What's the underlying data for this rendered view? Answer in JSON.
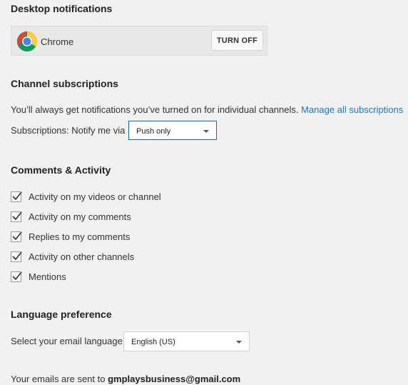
{
  "desktop_notifications": {
    "title": "Desktop notifications",
    "browser_name": "Chrome",
    "turn_off_label": "TURN OFF"
  },
  "channel_subscriptions": {
    "title": "Channel subscriptions",
    "description": "You’ll always get notifications you’ve turned on for individual channels.",
    "manage_link": "Manage all subscriptions",
    "notify_label": "Subscriptions: Notify me via",
    "notify_value": "Push only"
  },
  "comments_activity": {
    "title": "Comments & Activity",
    "items": [
      {
        "label": "Activity on my videos or channel",
        "checked": true
      },
      {
        "label": "Activity on my comments",
        "checked": true
      },
      {
        "label": "Replies to my comments",
        "checked": true
      },
      {
        "label": "Activity on other channels",
        "checked": true
      },
      {
        "label": "Mentions",
        "checked": true
      }
    ]
  },
  "language_preference": {
    "title": "Language preference",
    "select_label": "Select your email language",
    "selected": "English (US)"
  },
  "footer": {
    "prefix": "Your emails are sent to",
    "email": "gmplaysbusiness@gmail.com"
  },
  "colors": {
    "background": "#f1f1f1",
    "link": "#167ac6",
    "focus_border": "#1c62b9"
  }
}
